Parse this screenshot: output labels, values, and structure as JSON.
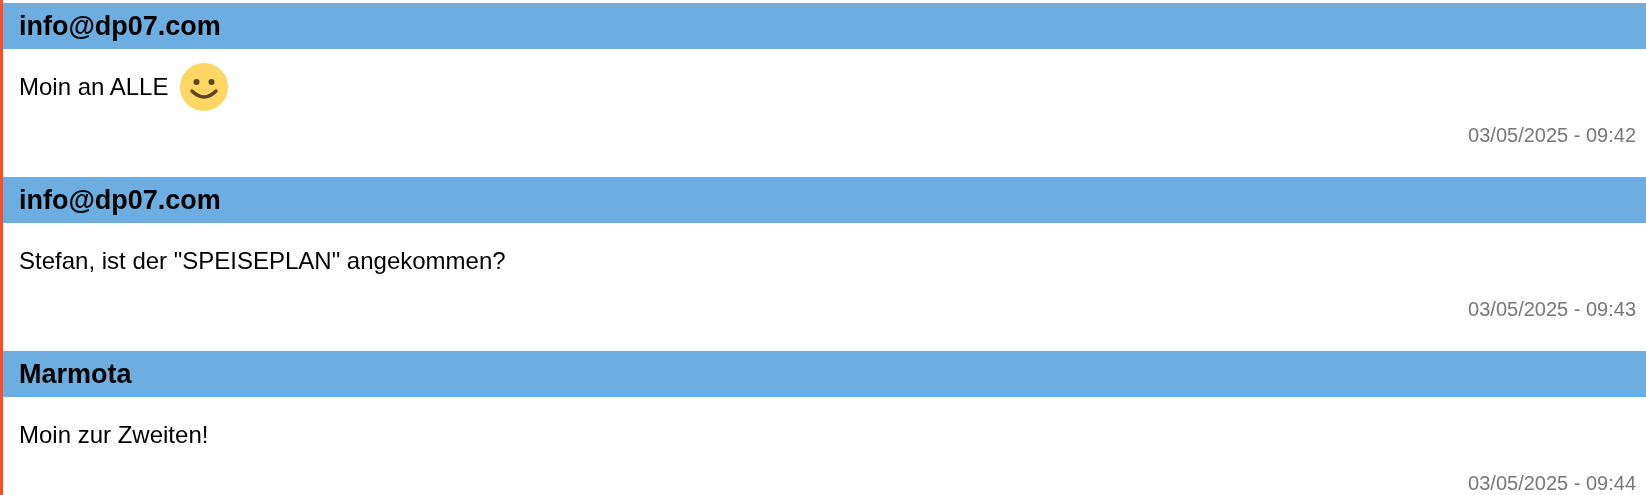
{
  "messages": [
    {
      "author": "info@dp07.com",
      "text": "Moin an ALLE",
      "smiley": true,
      "time": "03/05/2025 - 09:42"
    },
    {
      "author": "info@dp07.com",
      "text": "Stefan, ist der \"SPEISEPLAN\" angekommen?",
      "smiley": false,
      "time": "03/05/2025 - 09:43"
    },
    {
      "author": "Marmota",
      "text": "Moin zur Zweiten!",
      "smiley": false,
      "time": "03/05/2025 - 09:44"
    }
  ]
}
